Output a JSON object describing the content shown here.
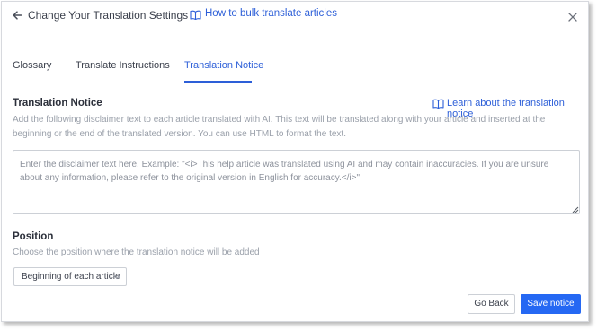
{
  "header": {
    "back_icon": "arrow-left-icon",
    "title": "Change Your Translation Settings",
    "help_icon": "book-icon",
    "help_link": "How to bulk translate articles",
    "close_icon": "close-icon"
  },
  "tabs": [
    {
      "label": "Glossary",
      "active": false
    },
    {
      "label": "Translate Instructions",
      "active": false
    },
    {
      "label": "Translation Notice",
      "active": true
    }
  ],
  "notice": {
    "title": "Translation Notice",
    "learn_icon": "book-icon",
    "learn_link": "Learn about the translation notice",
    "description": "Add the following disclaimer text to each article translated with AI. This text will be translated along with your article and inserted at the beginning or the end of the translated version. You can use HTML to format the text.",
    "value": "",
    "placeholder": "Enter the disclaimer text here. Example: \"<i>This help article was translated using AI and may contain inaccuracies. If you are unsure about any information, please refer to the original version in English for accuracy.</i>\""
  },
  "position": {
    "title": "Position",
    "description": "Choose the position where the translation notice will be added",
    "selected": "Beginning of each article",
    "chevron_icon": "chevron-down-icon"
  },
  "footer": {
    "back_label": "Go Back",
    "save_label": "Save notice"
  },
  "colors": {
    "accent": "#2d5fd8",
    "primary_button": "#2568f3",
    "muted_text": "#9aa0aa",
    "border": "#ccd0d6"
  }
}
